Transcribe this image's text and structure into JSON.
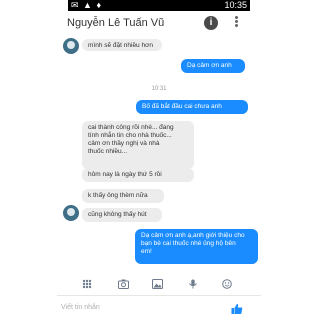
{
  "status_bar": {
    "time": "10:35"
  },
  "header": {
    "contact_name": "Nguyễn Lê Tuấn Vũ"
  },
  "messages": {
    "m1": "mình sẽ đặt nhiều hơn",
    "m2": "Dạ cảm ơn anh",
    "timestamp": "10:31",
    "m3": "Bố đã bắt đầu cai chưa anh",
    "m4_line1": "cai thành công rồi nhé... đang",
    "m4_line2": "tính nhắn tin cho nhà thuốc...",
    "m4_line3": "cảm ơn thầy nghị và nhà",
    "m4_line4": "thuốc nhiều...",
    "m5": "hôm nay là ngày thứ 5 rồi",
    "m6": "k thấy ông thèm nữa",
    "m7": "cũng không thấy hút",
    "m8_line1": "Dạ cảm ơn anh ạ,anh giới thiệu cho",
    "m8_line2": "bạn bè cai thuốc nhé ủng hộ bên",
    "m8_line3": "em!"
  },
  "composer": {
    "placeholder": "Viết tin nhắn"
  },
  "colors": {
    "outgoing": "#1a8cff",
    "incoming": "#ececec"
  }
}
